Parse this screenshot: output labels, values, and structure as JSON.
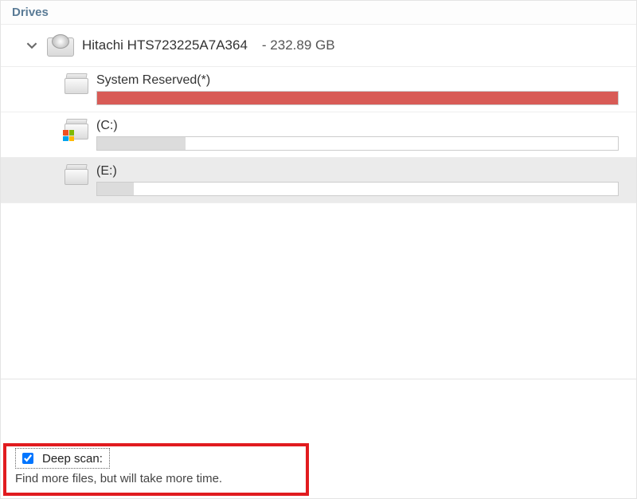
{
  "header": {
    "tab_label": "Drives"
  },
  "drive": {
    "name": "Hitachi HTS723225A7A364",
    "size_label": "- 232.89 GB"
  },
  "partitions": [
    {
      "label": "System Reserved(*)",
      "fill_color": "red",
      "fill_percent": 100,
      "has_win_logo": false,
      "selected": false
    },
    {
      "label": "(C:)",
      "fill_color": "grey",
      "fill_percent": 17,
      "has_win_logo": true,
      "selected": false
    },
    {
      "label": "(E:)",
      "fill_color": "grey",
      "fill_percent": 7,
      "has_win_logo": false,
      "selected": true
    }
  ],
  "footer": {
    "deepscan_label": "Deep scan:",
    "deepscan_checked": true,
    "deepscan_description": "Find more files, but will take more time."
  }
}
